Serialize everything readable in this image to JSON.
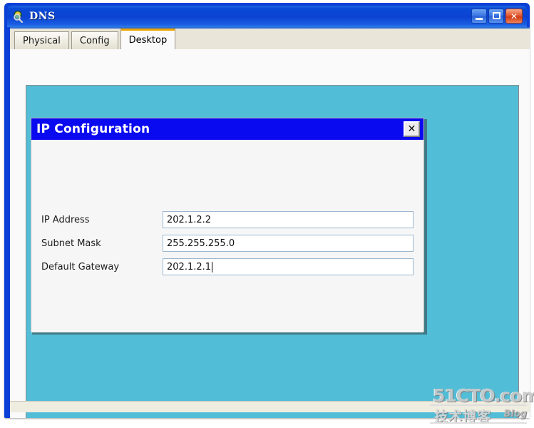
{
  "window": {
    "title": "DNS",
    "icon": "dns-magnifier-icon",
    "buttons": {
      "minimize": "minimize-button",
      "maximize": "maximize-button",
      "close_label": "✕"
    }
  },
  "tabs": [
    {
      "label": "Physical",
      "active": false
    },
    {
      "label": "Config",
      "active": false
    },
    {
      "label": "Desktop",
      "active": true
    }
  ],
  "dialog": {
    "title": "IP Configuration",
    "close_label": "✕",
    "fields": [
      {
        "label": "IP Address",
        "value": "202.1.2.2",
        "focused": false
      },
      {
        "label": "Subnet Mask",
        "value": "255.255.255.0",
        "focused": false
      },
      {
        "label": "Default Gateway",
        "value": "202.1.2.1",
        "focused": true
      }
    ]
  },
  "watermark": {
    "main": "51CTO.com",
    "sub": "技术博客",
    "blog": "Blog"
  },
  "colors": {
    "titlebar_blue": "#0b42d2",
    "dialog_blue": "#0a0af0",
    "desktop_teal": "#52bdd6",
    "active_tab_accent": "#f0a400",
    "tabstrip_beige": "#e9e5d8"
  }
}
